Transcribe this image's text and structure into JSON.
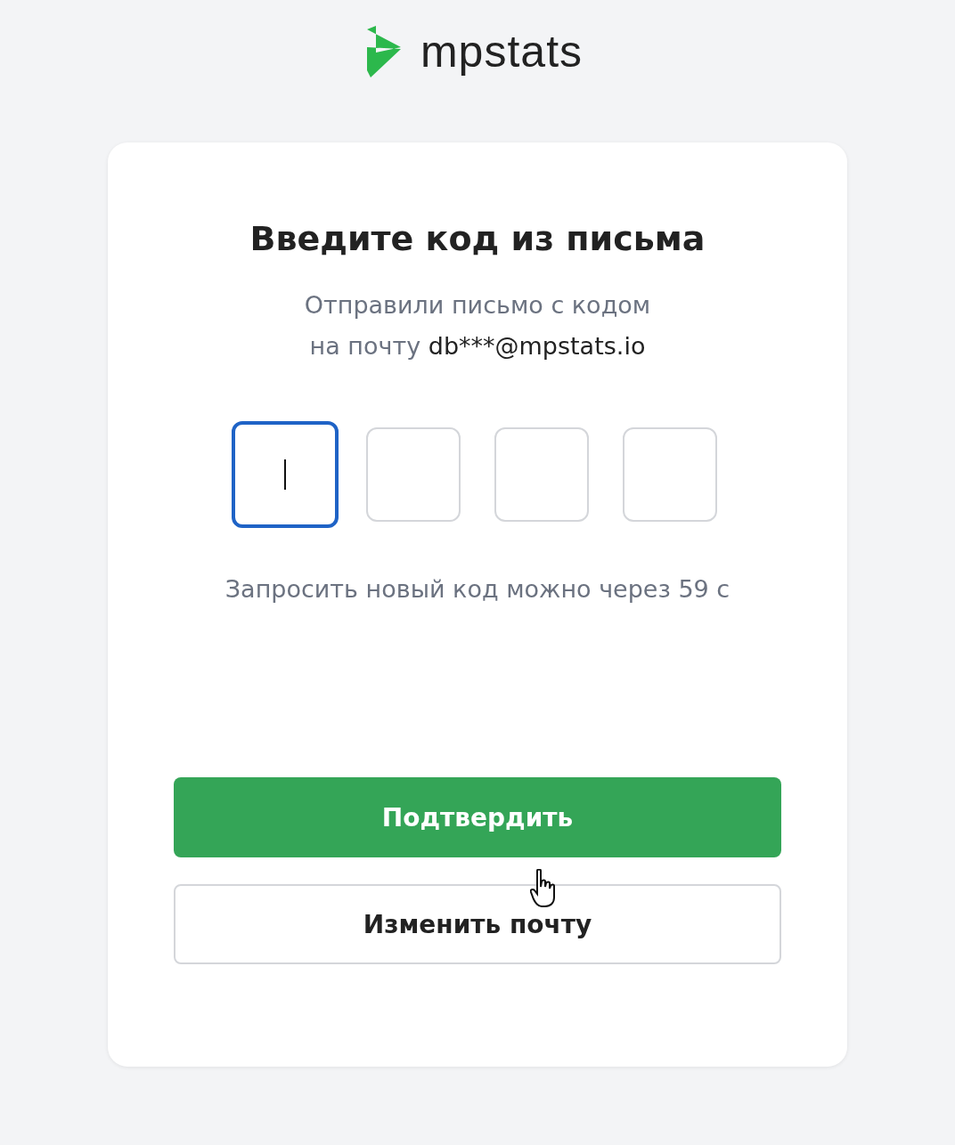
{
  "logo": {
    "text": "mpstats"
  },
  "title": "Введите код из письма",
  "subtitle": {
    "line1": "Отправили письмо с кодом",
    "line2_prefix": "на почту",
    "email": "db***@mpstats.io"
  },
  "code_fields": [
    {
      "focused": true
    },
    {
      "focused": false
    },
    {
      "focused": false
    },
    {
      "focused": false
    }
  ],
  "resend_note": "Запросить новый код можно через 59 с",
  "buttons": [
    {
      "kind": "primary",
      "label": "Подтвердить"
    },
    {
      "kind": "secondary",
      "label": "Изменить почту"
    }
  ]
}
